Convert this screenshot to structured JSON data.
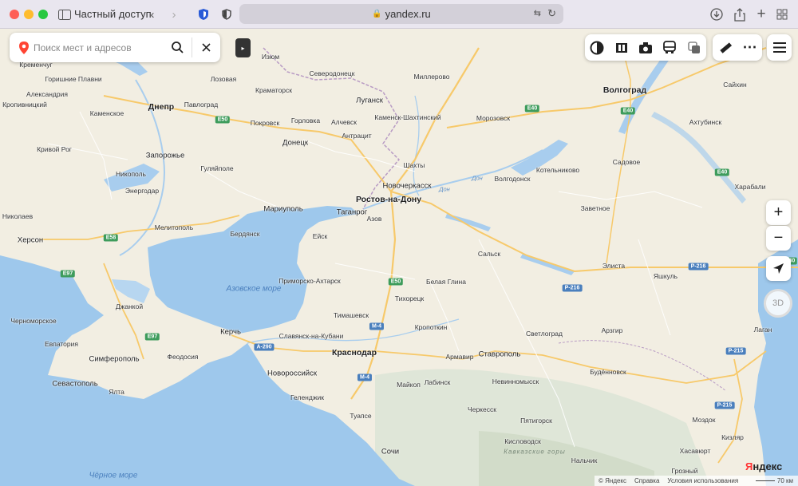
{
  "browser": {
    "tab_title": "Частный доступ",
    "url": "yandex.ru",
    "colors": {
      "close": "#fe5f57",
      "minimize": "#febc2e",
      "zoom": "#28c840"
    }
  },
  "search": {
    "placeholder": "Поиск мест и адресов",
    "value": ""
  },
  "toolbar": {
    "tools": [
      "layers-icon",
      "panorama-icon",
      "camera-icon",
      "transit-icon",
      "traffic-icon"
    ],
    "extra": [
      "ruler-icon",
      "more-icon"
    ],
    "menu": "menu-icon"
  },
  "controls": {
    "zoom_in": "+",
    "zoom_out": "−",
    "btn_3d": "3D"
  },
  "map": {
    "colors": {
      "land": "#f2eee2",
      "water": "#a8cdee",
      "sea": "#9ec8ec",
      "road": "#f7c96a",
      "border": "#b89bc4",
      "mountain": "#dfe6d8"
    },
    "cities": [
      {
        "name": "Ростов-на-Дону",
        "size": "big"
      },
      {
        "name": "Краснодар",
        "size": "big"
      },
      {
        "name": "Волгоград",
        "size": "big"
      },
      {
        "name": "Днепр",
        "size": "big"
      },
      {
        "name": "Донецк",
        "size": "med"
      },
      {
        "name": "Луганск",
        "size": "med"
      },
      {
        "name": "Запорожье",
        "size": "med"
      },
      {
        "name": "Мариуполь",
        "size": "med"
      },
      {
        "name": "Ставрополь",
        "size": "med"
      },
      {
        "name": "Таганрог",
        "size": "med"
      },
      {
        "name": "Новороссийск",
        "size": "med"
      },
      {
        "name": "Симферополь",
        "size": "med"
      },
      {
        "name": "Севастополь",
        "size": "med"
      },
      {
        "name": "Сочи",
        "size": "med"
      },
      {
        "name": "Херсон",
        "size": "med"
      },
      {
        "name": "Керчь",
        "size": "med"
      },
      {
        "name": "Новочеркасск",
        "size": "med"
      },
      {
        "name": "Кременчуг",
        "size": "small"
      },
      {
        "name": "Горишние Плавни",
        "size": "small"
      },
      {
        "name": "Александрия",
        "size": "small"
      },
      {
        "name": "Кропивницкий",
        "size": "small"
      },
      {
        "name": "Каменское",
        "size": "small"
      },
      {
        "name": "Кривой Рог",
        "size": "small"
      },
      {
        "name": "Никополь",
        "size": "small"
      },
      {
        "name": "Энергодар",
        "size": "small"
      },
      {
        "name": "Николаев",
        "size": "small"
      },
      {
        "name": "Лозовая",
        "size": "small"
      },
      {
        "name": "Изюм",
        "size": "small"
      },
      {
        "name": "Павлоград",
        "size": "small"
      },
      {
        "name": "Краматорск",
        "size": "small"
      },
      {
        "name": "Северодонецк",
        "size": "small"
      },
      {
        "name": "Миллерово",
        "size": "small"
      },
      {
        "name": "Покровск",
        "size": "small"
      },
      {
        "name": "Горловка",
        "size": "small"
      },
      {
        "name": "Алчевск",
        "size": "small"
      },
      {
        "name": "Каменск-Шахтинский",
        "size": "small"
      },
      {
        "name": "Морозовск",
        "size": "small"
      },
      {
        "name": "Антрацит",
        "size": "small"
      },
      {
        "name": "Гуляйполе",
        "size": "small"
      },
      {
        "name": "Шахты",
        "size": "small"
      },
      {
        "name": "Котельниково",
        "size": "small"
      },
      {
        "name": "Садовое",
        "size": "small"
      },
      {
        "name": "Волгодонск",
        "size": "small"
      },
      {
        "name": "Заветное",
        "size": "small"
      },
      {
        "name": "Мелитополь",
        "size": "small"
      },
      {
        "name": "Бердянск",
        "size": "small"
      },
      {
        "name": "Азов",
        "size": "small"
      },
      {
        "name": "Ейск",
        "size": "small"
      },
      {
        "name": "Сальск",
        "size": "small"
      },
      {
        "name": "Элиста",
        "size": "small"
      },
      {
        "name": "Яшкуль",
        "size": "small"
      },
      {
        "name": "Приморско-Ахтарск",
        "size": "small"
      },
      {
        "name": "Белая Глина",
        "size": "small"
      },
      {
        "name": "Тихорецк",
        "size": "small"
      },
      {
        "name": "Джанкой",
        "size": "small"
      },
      {
        "name": "Черноморское",
        "size": "small"
      },
      {
        "name": "Тимашевск",
        "size": "small"
      },
      {
        "name": "Кропоткин",
        "size": "small"
      },
      {
        "name": "Славянск-на-Кубани",
        "size": "small"
      },
      {
        "name": "Светлоград",
        "size": "small"
      },
      {
        "name": "Арзгир",
        "size": "small"
      },
      {
        "name": "Евпатория",
        "size": "small"
      },
      {
        "name": "Феодосия",
        "size": "small"
      },
      {
        "name": "Армавир",
        "size": "small"
      },
      {
        "name": "Будённовск",
        "size": "small"
      },
      {
        "name": "Ялта",
        "size": "small"
      },
      {
        "name": "Майкоп",
        "size": "small"
      },
      {
        "name": "Лабинск",
        "size": "small"
      },
      {
        "name": "Невинномысск",
        "size": "small"
      },
      {
        "name": "Геленджик",
        "size": "small"
      },
      {
        "name": "Черкесск",
        "size": "small"
      },
      {
        "name": "Туапсе",
        "size": "small"
      },
      {
        "name": "Пятигорск",
        "size": "small"
      },
      {
        "name": "Кисловодск",
        "size": "small"
      },
      {
        "name": "Хасавюрт",
        "size": "small"
      },
      {
        "name": "Кизляр",
        "size": "small"
      },
      {
        "name": "Моздок",
        "size": "small"
      },
      {
        "name": "Нальчик",
        "size": "small"
      },
      {
        "name": "Грозный",
        "size": "small"
      },
      {
        "name": "Сайхин",
        "size": "small"
      },
      {
        "name": "Ахтубинск",
        "size": "small"
      },
      {
        "name": "Харабали",
        "size": "small"
      },
      {
        "name": "Лаган",
        "size": "small"
      }
    ],
    "seas": [
      "Азовское море",
      "Чёрное море"
    ],
    "rivers": [
      "Дон",
      "Дон"
    ],
    "mountains": "Кавказские горы",
    "roads": [
      "E50",
      "E40",
      "E40",
      "E40",
      "E58",
      "E97",
      "E97",
      "E50",
      "M-4",
      "M-4",
      "A-290",
      "P-216",
      "P-216",
      "P-215",
      "P-215",
      "E40"
    ]
  },
  "footer": {
    "copyright": "© Яндекс",
    "help": "Справка",
    "terms": "Условия использования",
    "scale": "70 км"
  },
  "logo": {
    "first": "Я",
    "rest": "ндекс"
  }
}
